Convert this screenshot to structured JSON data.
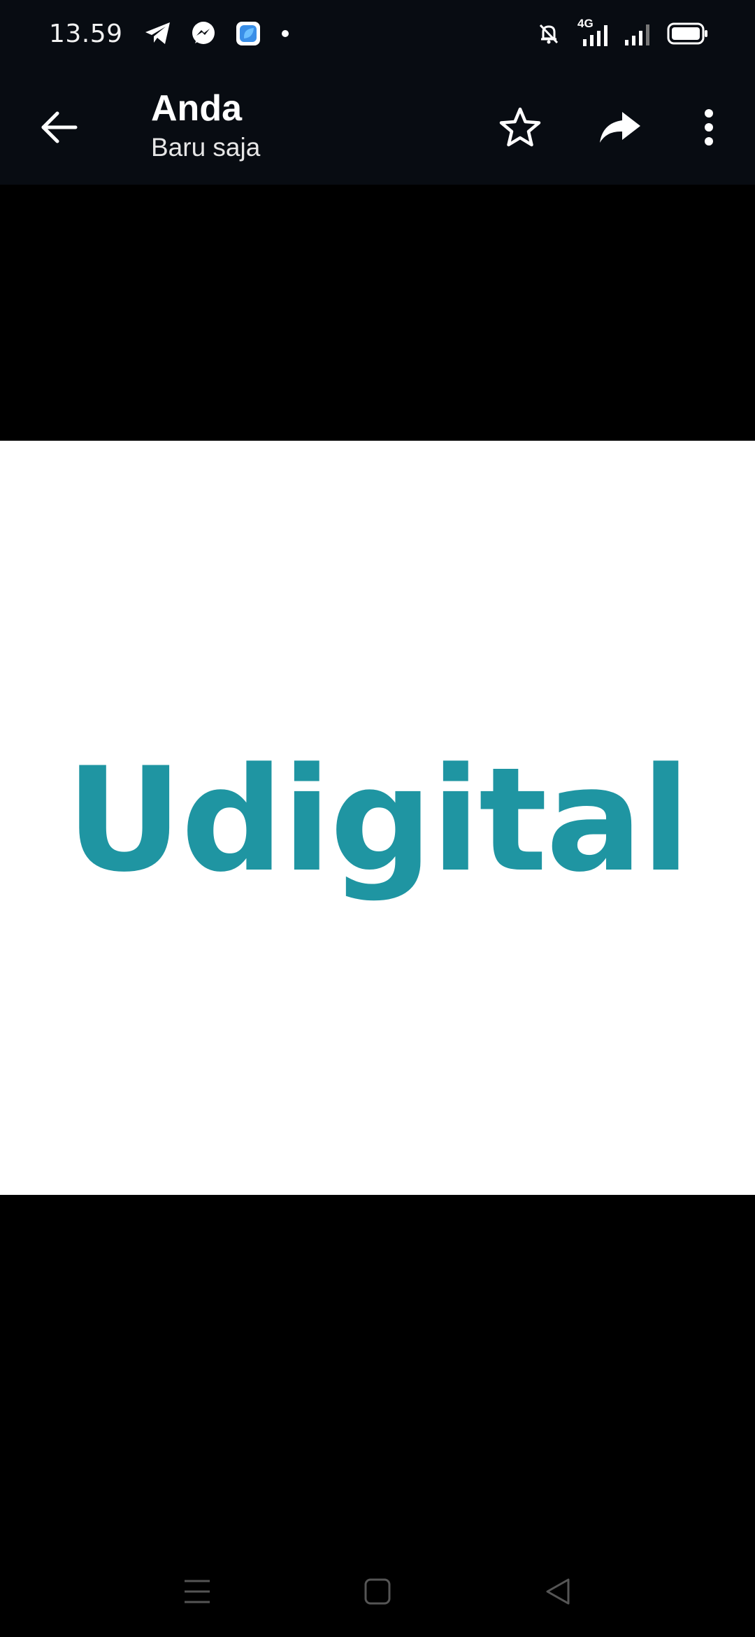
{
  "status_bar": {
    "time": "13.59",
    "network_label": "4G",
    "left_icons": [
      "telegram-icon",
      "messenger-icon",
      "app-icon",
      "dot-icon"
    ],
    "right_icons": [
      "mute-bell-icon",
      "signal-4g-icon",
      "signal-icon",
      "battery-icon"
    ]
  },
  "toolbar": {
    "title": "Anda",
    "subtitle": "Baru saja"
  },
  "image": {
    "logo_text": "Udigital",
    "logo_color": "#1f95a2",
    "background": "#ffffff"
  },
  "colors": {
    "bar_background": "#080c12",
    "viewer_background": "#000000"
  }
}
